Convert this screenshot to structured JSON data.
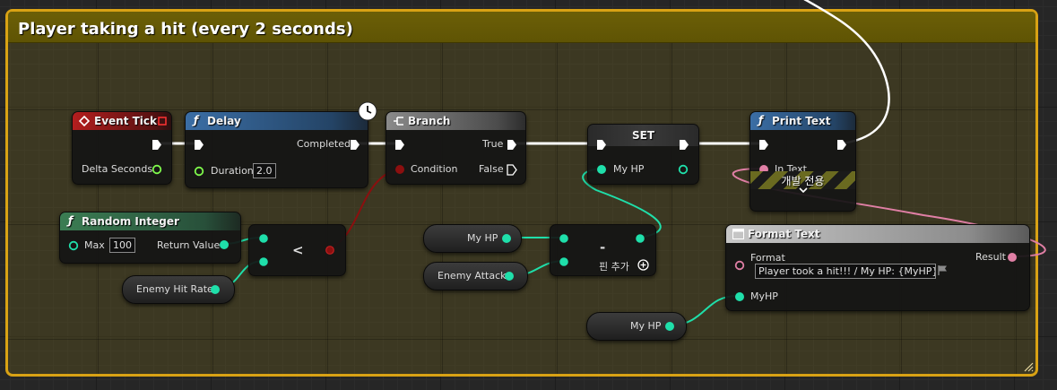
{
  "comment": {
    "title": "Player taking a hit (every 2 seconds)"
  },
  "nodes": {
    "event_tick": {
      "title": "Event Tick",
      "pins": {
        "delta_seconds": "Delta Seconds"
      }
    },
    "delay": {
      "title": "Delay",
      "pins": {
        "completed": "Completed",
        "duration": "Duration"
      },
      "duration_value": "2.0"
    },
    "branch": {
      "title": "Branch",
      "pins": {
        "condition": "Condition",
        "true": "True",
        "false": "False"
      }
    },
    "set": {
      "title": "SET",
      "pins": {
        "my_hp": "My HP"
      }
    },
    "print_text": {
      "title": "Print Text",
      "pins": {
        "in_text": "In Text"
      },
      "dev_only_label": "개발 전용"
    },
    "random_integer": {
      "title": "Random Integer",
      "pins": {
        "max": "Max",
        "return_value": "Return Value"
      },
      "max_value": "100"
    },
    "less_than": {
      "symbol": "<"
    },
    "subtract": {
      "symbol": "-",
      "add_pin_label": "핀 추가"
    },
    "format_text": {
      "title": "Format Text",
      "pins": {
        "format": "Format",
        "result": "Result",
        "myhp": "MyHP"
      },
      "format_value": "Player took a hit!!! / My HP: {MyHP}"
    }
  },
  "variables": {
    "enemy_hit_rate": "Enemy Hit Rate",
    "my_hp_a": "My HP",
    "enemy_attack": "Enemy Attack",
    "my_hp_b": "My HP"
  },
  "colors": {
    "exec": "#ffffff",
    "float": "#7ef84b",
    "integer": "#1fdfaa",
    "bool": "#8c0f0f",
    "text": "#e07fa5",
    "comment_border": "#d9a214",
    "comment_header": "#6c5f07"
  },
  "icons": {
    "event": "event-diamond-icon",
    "function": "function-f-icon",
    "branch": "branch-icon",
    "clock": "clock-icon",
    "format_text": "format-text-icon",
    "add_pin": "add-pin-plus-icon",
    "expand": "chevron-down-icon",
    "flag": "flag-icon"
  }
}
